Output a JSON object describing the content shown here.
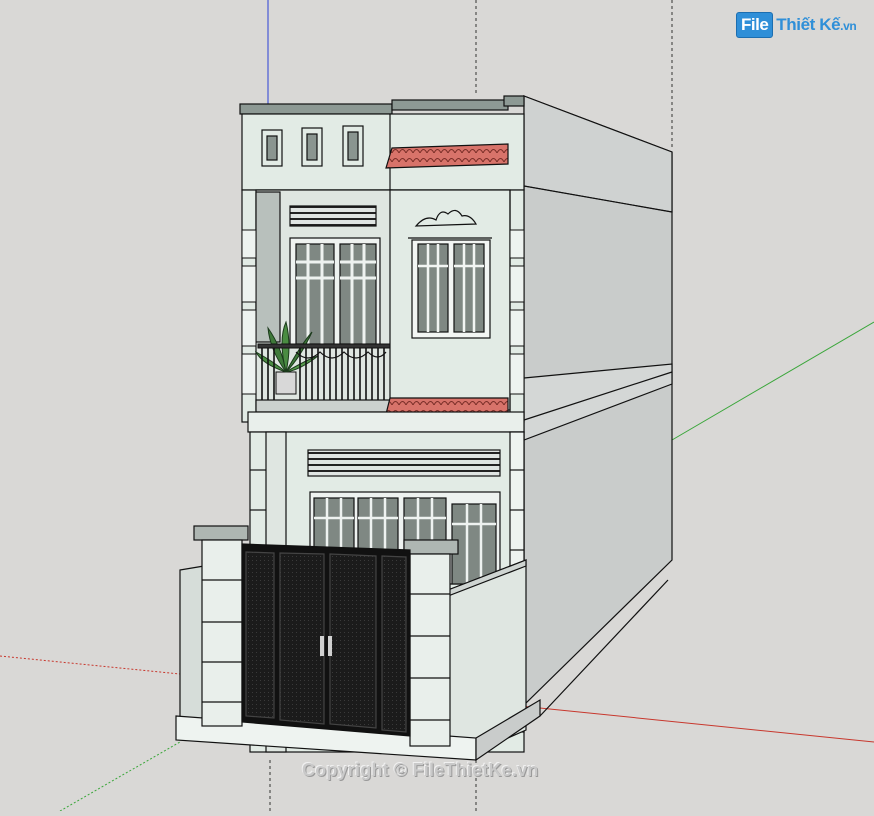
{
  "watermark": {
    "logo_box": "File",
    "logo_name": "Thiết Kế",
    "logo_tld": ".vn",
    "copyright": "Copyright © FileThietKe.vn",
    "brand_color": "#2f8fd8"
  },
  "scene": {
    "background": "#d9d8d6",
    "axis_colors": {
      "red": "#c8372d",
      "green": "#3aa63a",
      "blue": "#2b3fd6"
    },
    "facade_color": "#e2ebe5",
    "side_color": "#c9cccb",
    "roof_tile_color": "#d8736a",
    "railing_color": "#222222",
    "gate_color": "#1b1b1b"
  }
}
